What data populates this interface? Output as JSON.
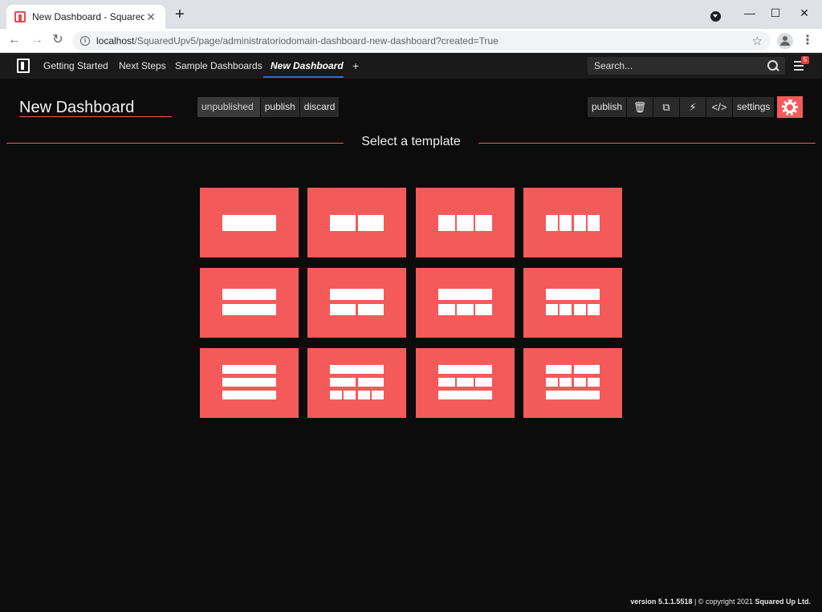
{
  "browser": {
    "tab_title": "New Dashboard - SquaredUp",
    "tab_close": "✕",
    "new_tab": "+",
    "url_host": "localhost",
    "url_path": "/SquaredUpv5/page/administratoriodomain-dashboard-new-dashboard?created=True",
    "minimize": "—",
    "maximize": "☐",
    "close": "✕",
    "back": "←",
    "forward": "→",
    "reload": "↻",
    "star": "☆",
    "menu": "⋮"
  },
  "nav": {
    "items": [
      {
        "label": "Getting Started"
      },
      {
        "label": "Next Steps"
      },
      {
        "label": "Sample Dashboards"
      },
      {
        "label": "New Dashboard"
      }
    ],
    "plus": "+",
    "search_placeholder": "Search...",
    "notifications": "5"
  },
  "dashboard": {
    "title": "New Dashboard",
    "state": {
      "unpublished": "unpublished",
      "publish": "publish",
      "discard": "discard"
    },
    "tools": {
      "publish": "publish",
      "delete": "🗑",
      "copy": "⧉",
      "flash": "⚡",
      "code": "</>",
      "settings": "settings"
    }
  },
  "template_title": "Select a template",
  "footer": {
    "version": "version 5.1.1.5518",
    "copyright": "| © copyright 2021",
    "company": "Squared Up Ltd."
  },
  "colors": {
    "accent": "#f55a5a",
    "background": "#0c0c0c",
    "nav": "#1a1a1a"
  }
}
